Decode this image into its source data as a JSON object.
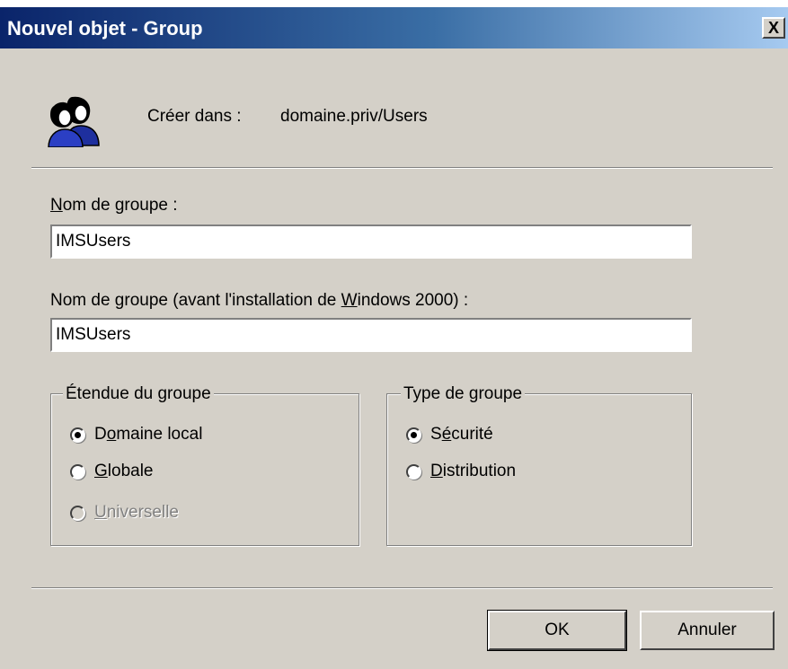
{
  "window": {
    "title": "Nouvel objet - Group",
    "close_label": "X"
  },
  "header": {
    "icon": "user-group-icon",
    "create_in_label": "Créer dans :",
    "create_in_value": "domaine.priv/Users"
  },
  "fields": {
    "group_name": {
      "label_mnemonic": "N",
      "label_rest": "om de groupe :",
      "value": "IMSUsers"
    },
    "group_name_pre2000": {
      "label_before": "Nom de groupe (avant l'installation de ",
      "label_mnemonic": "W",
      "label_after": "indows 2000) :",
      "value": "IMSUsers"
    }
  },
  "scope": {
    "legend": "Étendue du groupe",
    "options": [
      {
        "pre": "D",
        "mnemonic": "o",
        "post": "maine local",
        "checked": true,
        "enabled": true
      },
      {
        "pre": "",
        "mnemonic": "G",
        "post": "lobale",
        "checked": false,
        "enabled": true
      },
      {
        "pre": "",
        "mnemonic": "U",
        "post": "niverselle",
        "checked": false,
        "enabled": false
      }
    ]
  },
  "type": {
    "legend": "Type de groupe",
    "options": [
      {
        "pre": "S",
        "mnemonic": "é",
        "post": "curité",
        "checked": true,
        "enabled": true
      },
      {
        "pre": "",
        "mnemonic": "D",
        "post": "istribution",
        "checked": false,
        "enabled": true
      }
    ]
  },
  "buttons": {
    "ok": "OK",
    "cancel": "Annuler"
  },
  "colors": {
    "titlebar_start": "#0a246a",
    "titlebar_end": "#a6caf0",
    "dialog_bg": "#d4d0c8"
  }
}
